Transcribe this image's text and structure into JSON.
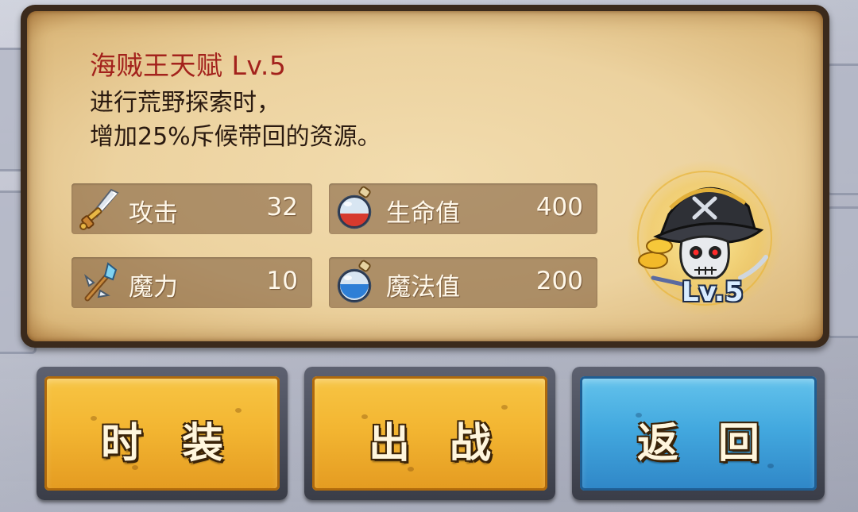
{
  "talent": {
    "title": "海贼王天赋 Lv.5",
    "desc_line1": "进行荒野探索时，",
    "desc_line2": "增加25%斥候带回的资源。"
  },
  "stats": [
    {
      "label": "攻击",
      "value": "32",
      "icon": "sword-icon"
    },
    {
      "label": "生命值",
      "value": "400",
      "icon": "red-potion-icon"
    },
    {
      "label": "魔力",
      "value": "10",
      "icon": "magic-staff-icon"
    },
    {
      "label": "魔法值",
      "value": "200",
      "icon": "blue-potion-icon"
    }
  ],
  "hero_badge": {
    "level_text": "Lv.5",
    "icon": "pirate-skull-icon"
  },
  "buttons": {
    "costume": "时 装",
    "battle": "出 战",
    "back": "返 回"
  },
  "colors": {
    "title": "#a3221c",
    "gold_button": "#f3b632",
    "blue_button": "#43a9df",
    "parchment": "#ecd29f"
  }
}
